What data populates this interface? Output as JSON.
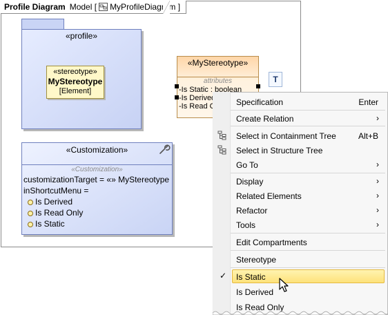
{
  "frame": {
    "title": "Profile Diagram",
    "model_label": "Model [",
    "diagram_name": "MyProfileDiagram ]",
    "diagram_icon": "diagram-icon"
  },
  "profile": {
    "label": "«profile»"
  },
  "stereotype_element": {
    "stereo": "«stereotype»",
    "name": "MyStereotype",
    "meta": "[Element]"
  },
  "my_stereotype": {
    "stereo": "«MyStereotype»",
    "compartment": "attributes",
    "lines": [
      "-Is Static : boolean",
      "-Is Derived",
      "-Is Read O"
    ]
  },
  "smart_button": {
    "icon": "text-format-icon",
    "label": "T"
  },
  "customization": {
    "stereo": "«Customization»",
    "compartment": "«Customization»",
    "target_line": "customizationTarget = «» MyStereotype",
    "menu_line": "inShortcutMenu =",
    "items": [
      "Is Derived",
      "Is Read Only",
      "Is Static"
    ],
    "icon": "wrench-icon"
  },
  "context_menu": {
    "items": [
      {
        "label": "Specification",
        "shortcut": "Enter"
      },
      {
        "label": "Create Relation",
        "submenu": true
      },
      {
        "label": "Select in Containment Tree",
        "shortcut": "Alt+B",
        "icon": "containment-tree-icon"
      },
      {
        "label": "Select in Structure Tree",
        "icon": "structure-tree-icon"
      },
      {
        "label": "Go To",
        "submenu": true
      },
      {
        "label": "Display",
        "submenu": true
      },
      {
        "label": "Related Elements",
        "submenu": true
      },
      {
        "label": "Refactor",
        "submenu": true
      },
      {
        "label": "Tools",
        "submenu": true
      },
      {
        "label": "Edit Compartments"
      },
      {
        "label": "Stereotype"
      },
      {
        "label": "Is Static",
        "checked": true,
        "selected": true
      },
      {
        "label": "Is Derived"
      },
      {
        "label": "Is Read Only"
      }
    ],
    "submenu_arrow": "›",
    "check_mark": "✓"
  },
  "colors": {
    "profile_fill": "#c9d4f5",
    "stereotype_fill": "#fff8c9",
    "my_stereotype_fill": "#ffd6a8",
    "highlight": "#fde27a"
  }
}
